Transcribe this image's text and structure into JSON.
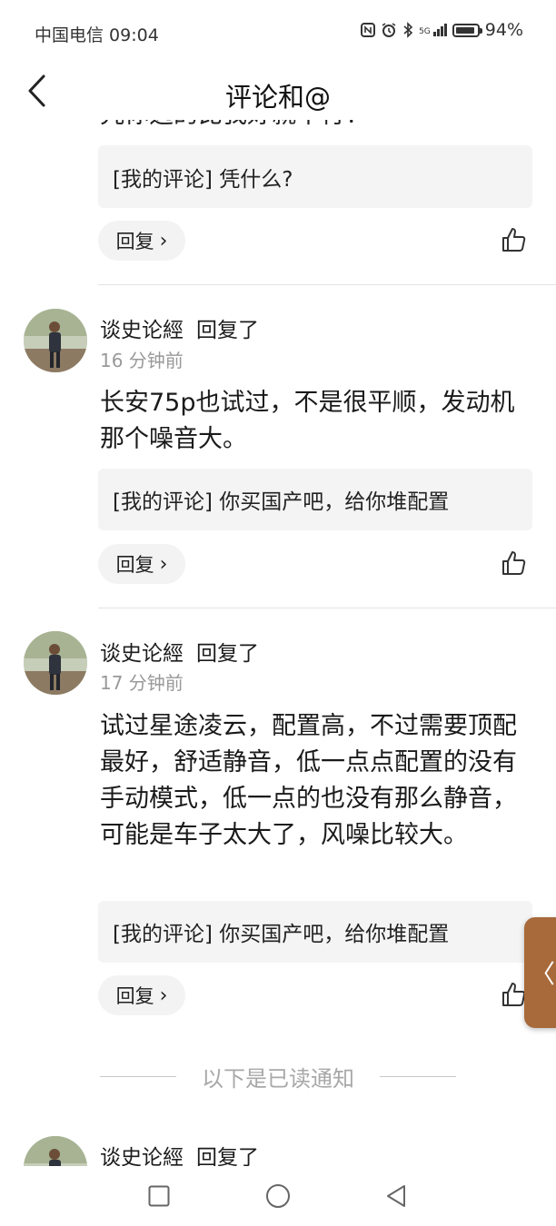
{
  "status_bar": {
    "carrier_time": "中国电信 09:04",
    "icons": [
      "nfc-icon",
      "alarm-icon",
      "bluetooth-icon",
      "signal-5g-icon"
    ],
    "network": "5G",
    "battery": "94%",
    "battery_level": 0.94
  },
  "header": {
    "title": "评论和@"
  },
  "items": [
    {
      "cut_text": "凭你选的比我好就不行！",
      "quote": "[我的评论] 凭什么?",
      "reply": "回复"
    },
    {
      "username": "谈史论經",
      "action": "回复了",
      "time": "16 分钟前",
      "text": "长安75p也试过，不是很平顺，发动机那个噪音大。",
      "quote": "[我的评论] 你买国产吧，给你堆配置",
      "reply": "回复"
    },
    {
      "username": "谈史论經",
      "action": "回复了",
      "time": "17 分钟前",
      "text": "试过星途凌云，配置高，不过需要顶配最好，舒适静音，低一点点配置的没有手动模式，低一点的也没有那么静音，可能是车子太大了，风噪比较大。",
      "quote": "[我的评论] 你买国产吧，给你堆配置",
      "reply": "回复"
    },
    {
      "username": "谈史论經",
      "action": "回复了"
    }
  ],
  "read_separator": "以下是已读通知",
  "side_tab": {
    "glyph": "〈"
  },
  "colors": {
    "side_tab": "#a86a3b",
    "quote_bg": "#f4f4f4",
    "time": "#999999"
  }
}
